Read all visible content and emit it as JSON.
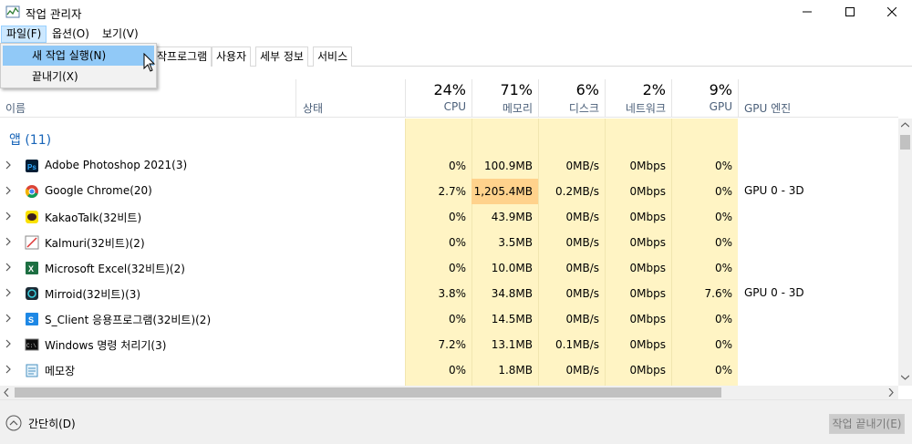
{
  "window": {
    "title": "작업 관리자"
  },
  "menu": {
    "file": "파일(F)",
    "options": "옵션(O)",
    "view": "보기(V)"
  },
  "file_menu": {
    "run_new_task": "새 작업 실행(N)",
    "exit": "끝내기(X)"
  },
  "tabs": [
    "작프로그램",
    "사용자",
    "세부 정보",
    "서비스"
  ],
  "columns": {
    "name": "이름",
    "status": "상태",
    "cpu": {
      "label": "CPU",
      "percent": "24%"
    },
    "memory": {
      "label": "메모리",
      "percent": "71%"
    },
    "disk": {
      "label": "디스크",
      "percent": "6%"
    },
    "network": {
      "label": "네트워크",
      "percent": "2%"
    },
    "gpu": {
      "label": "GPU",
      "percent": "9%"
    },
    "gpu_engine": "GPU 엔진"
  },
  "group": {
    "label": "앱 (11)"
  },
  "rows": [
    {
      "name": "Adobe Photoshop 2021(3)",
      "icon": "photoshop-icon",
      "cpu": "0%",
      "memory": "100.9MB",
      "disk": "0MB/s",
      "network": "0Mbps",
      "gpu": "0%",
      "gpu_engine": ""
    },
    {
      "name": "Google Chrome(20)",
      "icon": "chrome-icon",
      "cpu": "2.7%",
      "memory": "1,205.4MB",
      "disk": "0.2MB/s",
      "network": "0Mbps",
      "gpu": "0%",
      "gpu_engine": "GPU 0 - 3D"
    },
    {
      "name": "KakaoTalk(32비트)",
      "icon": "kakaotalk-icon",
      "cpu": "0%",
      "memory": "43.9MB",
      "disk": "0MB/s",
      "network": "0Mbps",
      "gpu": "0%",
      "gpu_engine": ""
    },
    {
      "name": "Kalmuri(32비트)(2)",
      "icon": "kalmuri-icon",
      "cpu": "0%",
      "memory": "3.5MB",
      "disk": "0MB/s",
      "network": "0Mbps",
      "gpu": "0%",
      "gpu_engine": ""
    },
    {
      "name": "Microsoft Excel(32비트)(2)",
      "icon": "excel-icon",
      "cpu": "0%",
      "memory": "10.0MB",
      "disk": "0MB/s",
      "network": "0Mbps",
      "gpu": "0%",
      "gpu_engine": ""
    },
    {
      "name": "Mirroid(32비트)(3)",
      "icon": "mirroid-icon",
      "cpu": "3.8%",
      "memory": "34.8MB",
      "disk": "0MB/s",
      "network": "0Mbps",
      "gpu": "7.6%",
      "gpu_engine": "GPU 0 - 3D"
    },
    {
      "name": "S_Client 응용프로그램(32비트)(2)",
      "icon": "s-client-icon",
      "cpu": "0%",
      "memory": "14.5MB",
      "disk": "0MB/s",
      "network": "0Mbps",
      "gpu": "0%",
      "gpu_engine": ""
    },
    {
      "name": "Windows 명령 처리기(3)",
      "icon": "cmd-icon",
      "cpu": "7.2%",
      "memory": "13.1MB",
      "disk": "0.1MB/s",
      "network": "0Mbps",
      "gpu": "0%",
      "gpu_engine": ""
    },
    {
      "name": "메모장",
      "icon": "notepad-icon",
      "cpu": "0%",
      "memory": "1.8MB",
      "disk": "0MB/s",
      "network": "0Mbps",
      "gpu": "0%",
      "gpu_engine": ""
    }
  ],
  "footer": {
    "collapse": "간단히(D)",
    "end_task": "작업 끝내기(E)"
  },
  "colors": {
    "heat_low": "#fff4c4",
    "heat_high": "#ffd28c",
    "group_text": "#1764b8",
    "menu_highlight": "#91c9f7"
  }
}
